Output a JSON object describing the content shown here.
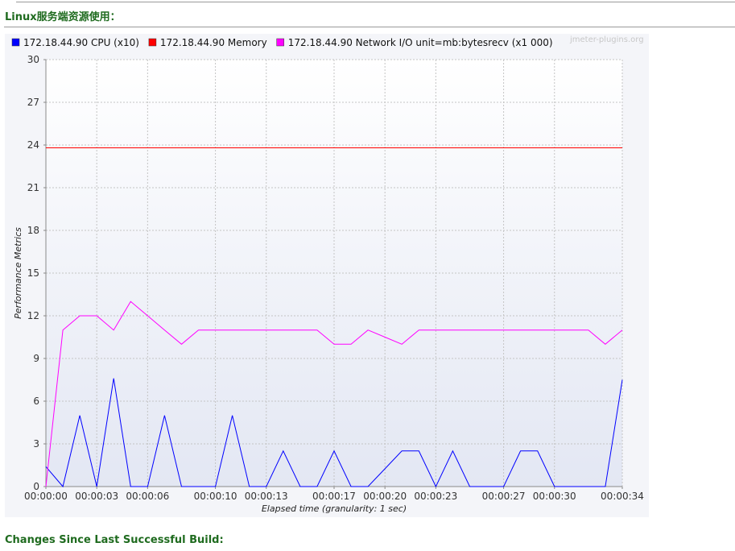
{
  "headings": {
    "linux": "Linux服务端资源使用：",
    "changes": "Changes Since Last Successful Build:"
  },
  "watermark": "jmeter-plugins.org",
  "chart_data": {
    "type": "line",
    "xlabel": "Elapsed time (granularity: 1 sec)",
    "ylabel": "Performance Metrics",
    "xlim": [
      0,
      34
    ],
    "ylim": [
      0,
      30
    ],
    "x_ticks": [
      0,
      3,
      6,
      10,
      13,
      17,
      20,
      23,
      27,
      30,
      34
    ],
    "x_tick_labels": [
      "00:00:00",
      "00:00:03",
      "00:00:06",
      "00:00:10",
      "00:00:13",
      "00:00:17",
      "00:00:20",
      "00:00:23",
      "00:00:27",
      "00:00:30",
      "00:00:34"
    ],
    "y_ticks": [
      0,
      3,
      6,
      9,
      12,
      15,
      18,
      21,
      24,
      27,
      30
    ],
    "grid": true,
    "legend_position": "top",
    "series": [
      {
        "name": "172.18.44.90 CPU (x10)",
        "color": "#0000ff",
        "x": [
          0,
          1,
          2,
          3,
          4,
          5,
          6,
          7,
          8,
          9,
          10,
          11,
          12,
          13,
          14,
          15,
          16,
          17,
          18,
          19,
          20,
          21,
          22,
          23,
          24,
          25,
          26,
          27,
          28,
          29,
          30,
          31,
          32,
          33,
          34
        ],
        "values": [
          1.4,
          0,
          5,
          0,
          7.6,
          0,
          0,
          5,
          0,
          0,
          0,
          5,
          0,
          0,
          2.5,
          0,
          0,
          2.5,
          0,
          0,
          1.25,
          2.5,
          2.5,
          0,
          2.5,
          0,
          0,
          0,
          2.5,
          2.5,
          0,
          0,
          0,
          0,
          7.5
        ]
      },
      {
        "name": "172.18.44.90 Memory",
        "color": "#ff0000",
        "x": [
          0,
          34
        ],
        "values": [
          23.8,
          23.8
        ]
      },
      {
        "name": "172.18.44.90 Network I/O unit=mb:bytesrecv (x1 000)",
        "color": "#ff00ff",
        "x": [
          0,
          1,
          2,
          3,
          4,
          5,
          6,
          7,
          8,
          9,
          10,
          11,
          12,
          13,
          14,
          15,
          16,
          17,
          18,
          19,
          20,
          21,
          22,
          23,
          24,
          25,
          26,
          27,
          28,
          29,
          30,
          31,
          32,
          33,
          34
        ],
        "values": [
          0,
          11,
          12,
          12,
          11,
          13,
          12,
          11,
          10,
          11,
          11,
          11,
          11,
          11,
          11,
          11,
          11,
          10,
          10,
          11,
          10.5,
          10,
          11,
          11,
          11,
          11,
          11,
          11,
          11,
          11,
          11,
          11,
          11,
          10,
          11
        ]
      }
    ]
  }
}
